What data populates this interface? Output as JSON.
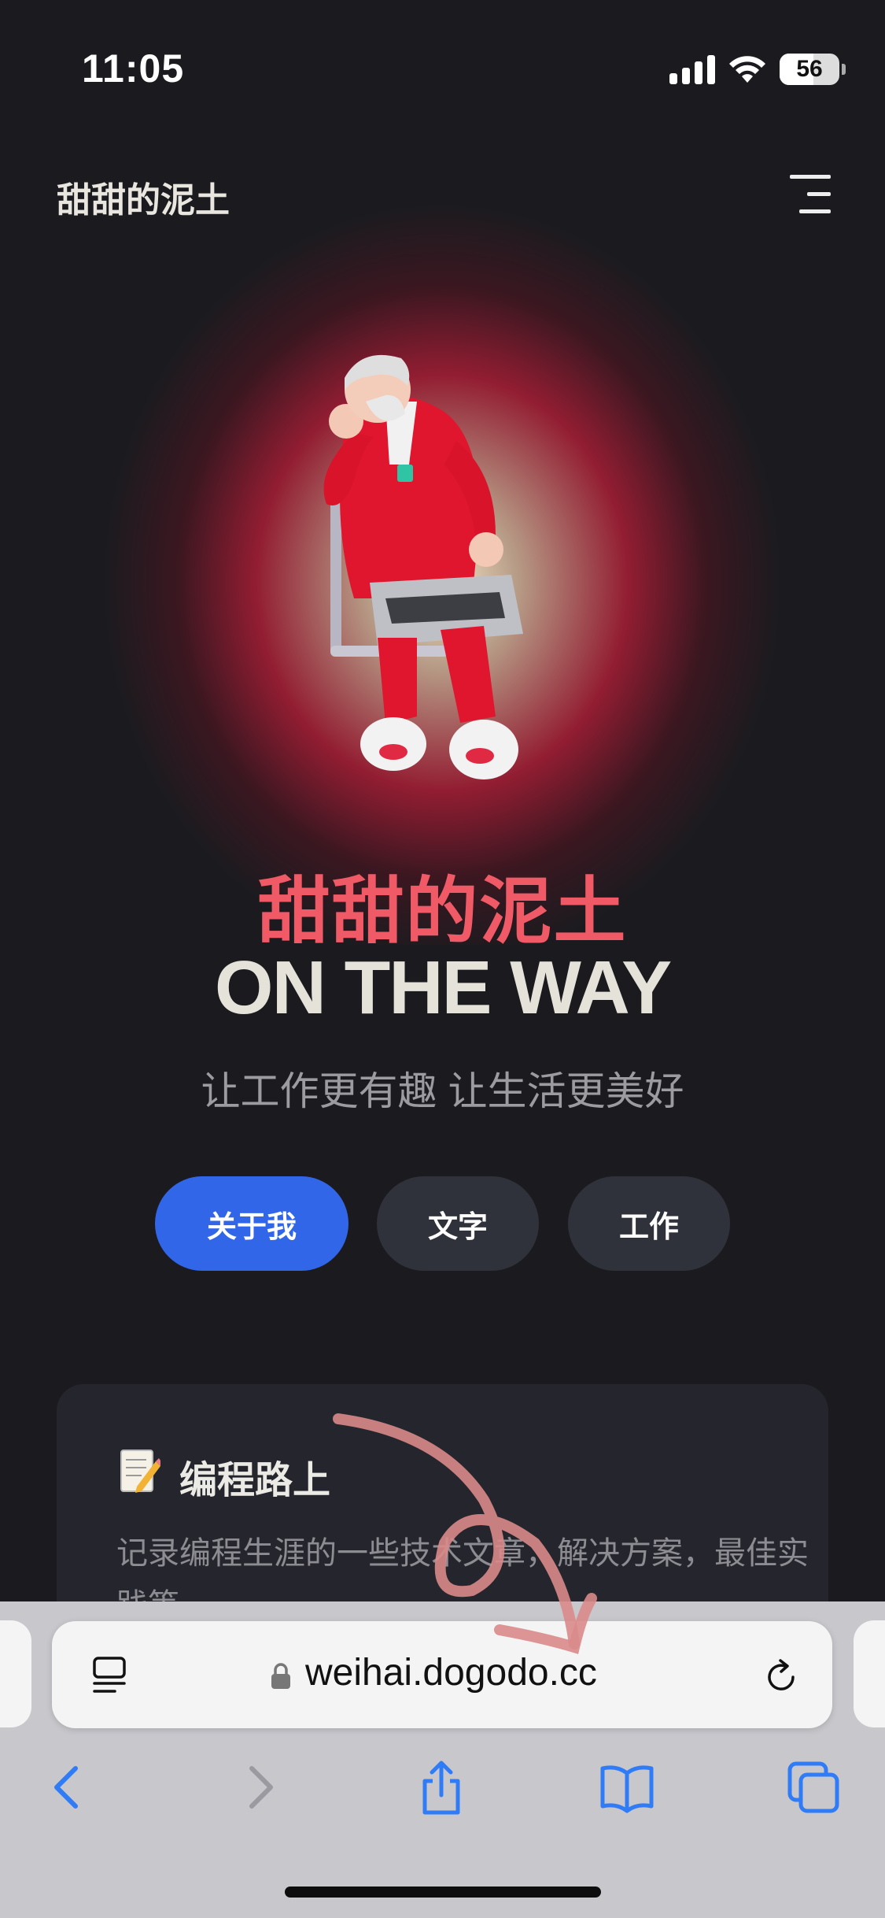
{
  "status_bar": {
    "time": "11:05",
    "battery": "56",
    "battery_level": 0.56
  },
  "header": {
    "site_title": "甜甜的泥土"
  },
  "hero": {
    "title_cn": "甜甜的泥土",
    "title_en": "ON THE WAY",
    "tagline": "让工作更有趣 让生活更美好"
  },
  "buttons": {
    "about": "关于我",
    "writing": "文字",
    "work": "工作"
  },
  "card": {
    "title": "编程路上",
    "description": "记录编程生涯的一些技术文章，解决方案，最佳实践等"
  },
  "safari": {
    "url": "weihai.dogodo.cc"
  },
  "colors": {
    "background": "#1b1b1f",
    "accent_blue": "#3266e8",
    "title_red": "#f05a66",
    "ios_blue": "#2f7cf6"
  },
  "icons": {
    "menu": "menu-icon",
    "reader": "reader-mode-icon",
    "lock": "lock-icon",
    "reload": "reload-icon",
    "back": "chevron-left-icon",
    "forward": "chevron-right-icon",
    "share": "share-icon",
    "bookmarks": "book-icon",
    "tabs": "tabs-icon"
  }
}
